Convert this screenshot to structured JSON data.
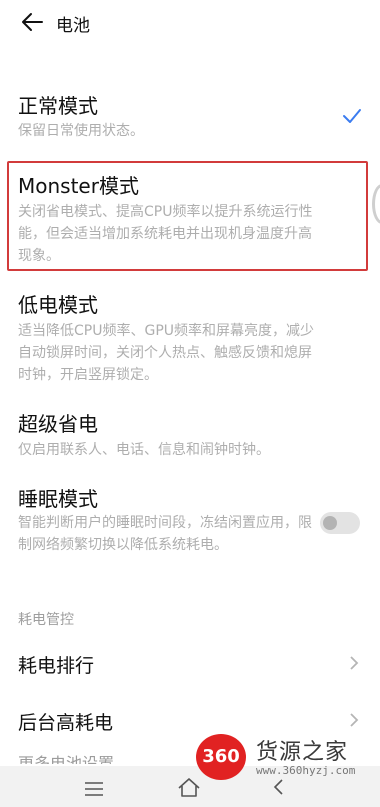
{
  "header": {
    "title": "电池"
  },
  "modes": [
    {
      "title": "正常模式",
      "desc": "保留日常使用状态。",
      "selected": true
    },
    {
      "title": "Monster模式",
      "desc": "关闭省电模式、提高CPU频率以提升系统运行性能，但会适当增加系统耗电并出现机身温度升高现象。",
      "selected": false
    },
    {
      "title": "低电模式",
      "desc": "适当降低CPU频率、GPU频率和屏幕亮度，减少自动锁屏时间，关闭个人热点、触感反馈和熄屏时钟，开启竖屏锁定。",
      "selected": false
    },
    {
      "title": "超级省电",
      "desc": "仅启用联系人、电话、信息和闹钟时钟。",
      "selected": false
    },
    {
      "title": "睡眠模式",
      "desc": "智能判断用户的睡眠时间段，冻结闲置应用，限制网络频繁切换以降低系统耗电。",
      "toggle_on": false
    }
  ],
  "section": {
    "label": "耗电管控"
  },
  "rows": [
    {
      "title": "耗电排行"
    },
    {
      "title": "后台高耗电"
    }
  ],
  "partial_row": "更多电池设置",
  "colors": {
    "accent": "#3b7cf0",
    "highlight": "#d23b3b",
    "watermark_red": "#e12222"
  },
  "watermark": {
    "logo": "360",
    "text": "货源之家",
    "url": "www.360hyzj.com"
  },
  "icons": {
    "back": "arrow-left-icon",
    "check": "checkmark-icon",
    "chevron": "chevron-right-icon"
  }
}
